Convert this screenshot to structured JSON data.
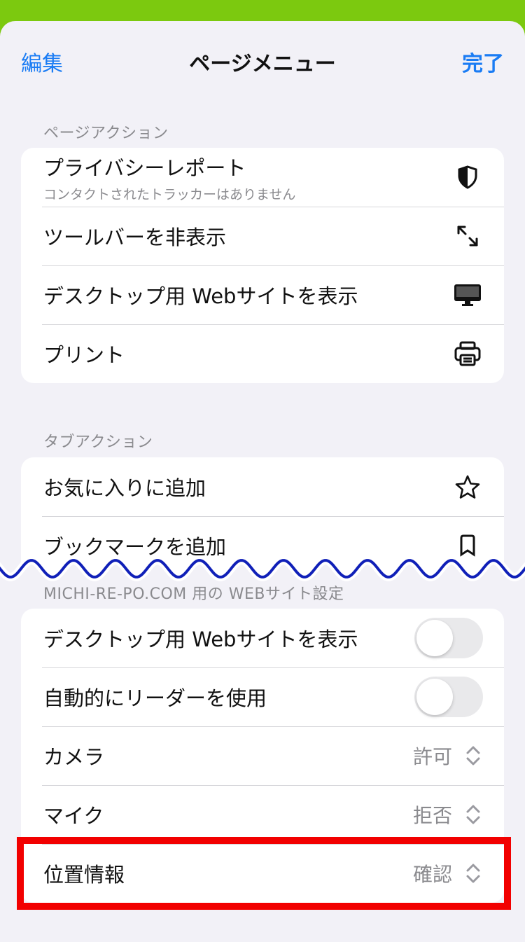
{
  "nav": {
    "edit": "編集",
    "title": "ページメニュー",
    "done": "完了"
  },
  "page_actions": {
    "header": "ページアクション",
    "privacy_title": "プライバシーレポート",
    "privacy_sub": "コンタクトされたトラッカーはありません",
    "hide_toolbar": "ツールバーを非表示",
    "desktop_site": "デスクトップ用 Webサイトを表示",
    "print": "プリント"
  },
  "tab_actions": {
    "header": "タブアクション",
    "add_favorite": "お気に入りに追加",
    "partial_row": "ブックマークを追加"
  },
  "site_settings": {
    "header": "MICHI-RE-PO.COM 用の WEBサイト設定",
    "desktop_site": "デスクトップ用 Webサイトを表示",
    "reader": "自動的にリーダーを使用",
    "camera": "カメラ",
    "camera_value": "許可",
    "mic": "マイク",
    "mic_value": "拒否",
    "location": "位置情報",
    "location_value": "確認"
  },
  "colors": {
    "accent": "#1a7cf4",
    "highlight": "#f20000",
    "background": "#7cc90f",
    "wave": "#1020b8"
  }
}
